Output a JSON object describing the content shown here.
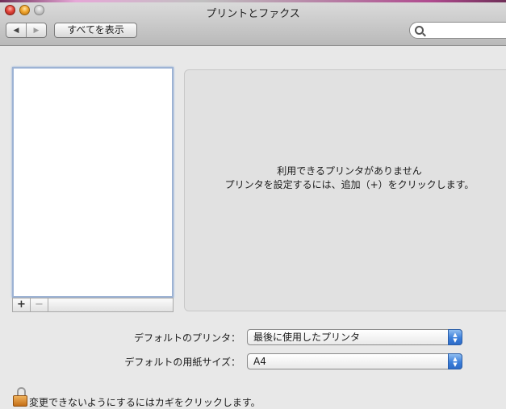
{
  "window": {
    "title": "プリントとファクス"
  },
  "toolbar": {
    "back_icon": "◀",
    "forward_icon": "▶",
    "show_all_label": "すべてを表示",
    "search_placeholder": ""
  },
  "printer_list": {
    "add_label": "+",
    "remove_label": "−"
  },
  "detail": {
    "no_printers": "利用できるプリンタがありません",
    "instructions": "プリンタを設定するには、追加（+）をクリックします。"
  },
  "settings": {
    "default_printer_label": "デフォルトのプリンタ：",
    "default_printer_value": "最後に使用したプリンタ",
    "paper_size_label": "デフォルトの用紙サイズ：",
    "paper_size_value": "A4"
  },
  "footer": {
    "lock_text": "変更できないようにするにはカギをクリックします。"
  }
}
